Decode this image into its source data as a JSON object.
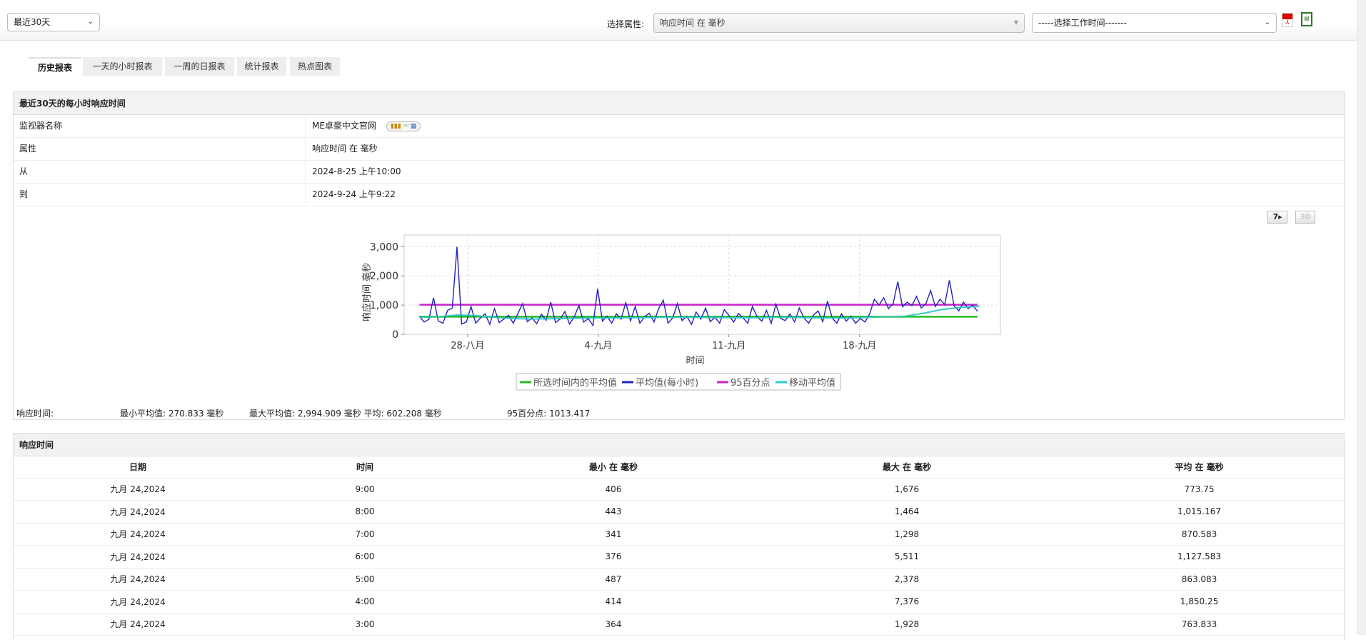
{
  "topbar": {
    "period_select": "最近30天",
    "attribute_label": "选择属性:",
    "attribute_select": "响应时间 在 毫秒",
    "worktime_select": "-----选择工作时间-------",
    "pdf_icon": "pdf-icon",
    "csv_icon": "csv-icon"
  },
  "tabs": [
    {
      "label": "历史报表",
      "active": true
    },
    {
      "label": "一天的小时报表"
    },
    {
      "label": "一周的日报表"
    },
    {
      "label": "统计报表"
    },
    {
      "label": "热点图表"
    }
  ],
  "summary": {
    "title": "最近30天的每小时响应时间",
    "rows": [
      {
        "key": "监视器名称",
        "value": "ME卓豪中文官网"
      },
      {
        "key": "属性",
        "value": "响应时间 在 毫秒"
      },
      {
        "key": "从",
        "value": "2024-8-25 上午10:00"
      },
      {
        "key": "到",
        "value": "2024-9-24 上午9:22"
      }
    ],
    "btn_7": "7",
    "btn_30": "30",
    "stats": {
      "label": "响应时间:",
      "min": "最小平均值:  270.833  毫秒",
      "max": "最大平均值:  2,994.909  毫秒 平均:  602.208  毫秒",
      "p95": "95百分点:  1013.417"
    }
  },
  "chart_data": {
    "type": "line",
    "xlabel": "时间",
    "ylabel": "响应时间 毫秒",
    "x_unit": "days since 2024-08-25 00:00",
    "xlim": [
      -0.4,
      31.55
    ],
    "ylim": [
      0,
      3400
    ],
    "yticks": [
      {
        "v": 0,
        "label": "0"
      },
      {
        "v": 1000,
        "label": "1,000"
      },
      {
        "v": 2000,
        "label": "2,000"
      },
      {
        "v": 3000,
        "label": "3,000"
      }
    ],
    "xticks": [
      {
        "v": 3,
        "label": "28-八月"
      },
      {
        "v": 10,
        "label": "4-九月"
      },
      {
        "v": 17,
        "label": "11-九月"
      },
      {
        "v": 24,
        "label": "18-九月"
      }
    ],
    "grid": true,
    "legend_position": "bottom",
    "series": [
      {
        "name": "所选时间内的平均值",
        "color": "#22bb22",
        "type": "constant",
        "value": 602.208
      },
      {
        "name": "平均值(每小时)",
        "color": "#2222bb",
        "x_start": 0.42,
        "x_step": 0.2513,
        "values": [
          620,
          420,
          510,
          1250,
          460,
          380,
          820,
          900,
          2995,
          350,
          420,
          950,
          380,
          560,
          700,
          340,
          880,
          400,
          520,
          650,
          380,
          720,
          1050,
          430,
          560,
          360,
          690,
          480,
          1100,
          400,
          520,
          780,
          350,
          600,
          980,
          420,
          540,
          300,
          1560,
          450,
          620,
          380,
          700,
          520,
          1080,
          460,
          950,
          380,
          600,
          720,
          420,
          880,
          1170,
          380,
          560,
          1050,
          470,
          620,
          340,
          760,
          520,
          900,
          430,
          580,
          380,
          850,
          640,
          420,
          710,
          560,
          380,
          950,
          600,
          450,
          820,
          380,
          1030,
          540,
          470,
          700,
          420,
          900,
          560,
          380,
          650,
          800,
          430,
          1140,
          560,
          380,
          700,
          450,
          620,
          380,
          540,
          420,
          700,
          1200,
          1000,
          1250,
          880,
          1050,
          1800,
          940,
          1100,
          980,
          1300,
          900,
          1050,
          1500,
          950,
          1200,
          1020,
          1850,
          980,
          800,
          1100,
          880,
          1000,
          780
        ]
      },
      {
        "name": "95百分点",
        "color": "#cc22cc",
        "type": "constant",
        "value": 1013.417
      },
      {
        "name": "移动平均值",
        "color": "#33cccc",
        "x_start": 0.42,
        "x_step": 1,
        "values": [
          580,
          600,
          660,
          640,
          580,
          540,
          520,
          530,
          540,
          560,
          560,
          570,
          570,
          580,
          580,
          580,
          575,
          570,
          570,
          580,
          580,
          570,
          560,
          560,
          580,
          600,
          620,
          720,
          850,
          920,
          960
        ]
      }
    ]
  },
  "table": {
    "title": "响应时间",
    "columns": [
      "日期",
      "时间",
      "最小 在 毫秒",
      "最大 在 毫秒",
      "平均 在 毫秒"
    ],
    "rows": [
      [
        "九月 24,2024",
        "9:00",
        "406",
        "1,676",
        "773.75"
      ],
      [
        "九月 24,2024",
        "8:00",
        "443",
        "1,464",
        "1,015.167"
      ],
      [
        "九月 24,2024",
        "7:00",
        "341",
        "1,298",
        "870.583"
      ],
      [
        "九月 24,2024",
        "6:00",
        "376",
        "5,511",
        "1,127.583"
      ],
      [
        "九月 24,2024",
        "5:00",
        "487",
        "2,378",
        "863.083"
      ],
      [
        "九月 24,2024",
        "4:00",
        "414",
        "7,376",
        "1,850.25"
      ],
      [
        "九月 24,2024",
        "3:00",
        "364",
        "1,928",
        "763.833"
      ]
    ]
  }
}
